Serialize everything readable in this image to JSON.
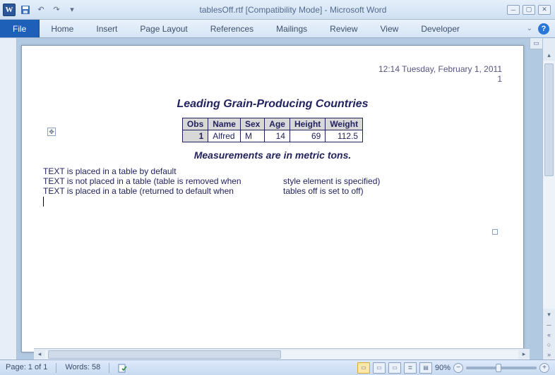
{
  "titlebar": {
    "app_icon_letter": "W",
    "title": "tablesOff.rtf [Compatibility Mode]  -  Microsoft Word"
  },
  "ribbon": {
    "file": "File",
    "tabs": [
      "Home",
      "Insert",
      "Page Layout",
      "References",
      "Mailings",
      "Review",
      "View",
      "Developer"
    ]
  },
  "doc": {
    "timestamp": "12:14 Tuesday, February 1, 2011",
    "pagenum": "1",
    "title": "Leading Grain-Producing Countries",
    "subtitle": "Measurements are in metric tons.",
    "table": {
      "headers": [
        "Obs",
        "Name",
        "Sex",
        "Age",
        "Height",
        "Weight"
      ],
      "rows": [
        {
          "obs": "1",
          "name": "Alfred",
          "sex": "M",
          "age": "14",
          "height": "69",
          "weight": "112.5"
        }
      ]
    },
    "paras": [
      {
        "left": "TEXT is placed  in a table by default",
        "right": ""
      },
      {
        "left": "TEXT is not placed in a table (table is removed when",
        "right": "style element is specified)"
      },
      {
        "left": "TEXT is placed  in a table (returned to default when",
        "right": "tables  off is set to off)"
      }
    ]
  },
  "status": {
    "page": "Page: 1 of 1",
    "words": "Words: 58",
    "zoom": "90%"
  }
}
